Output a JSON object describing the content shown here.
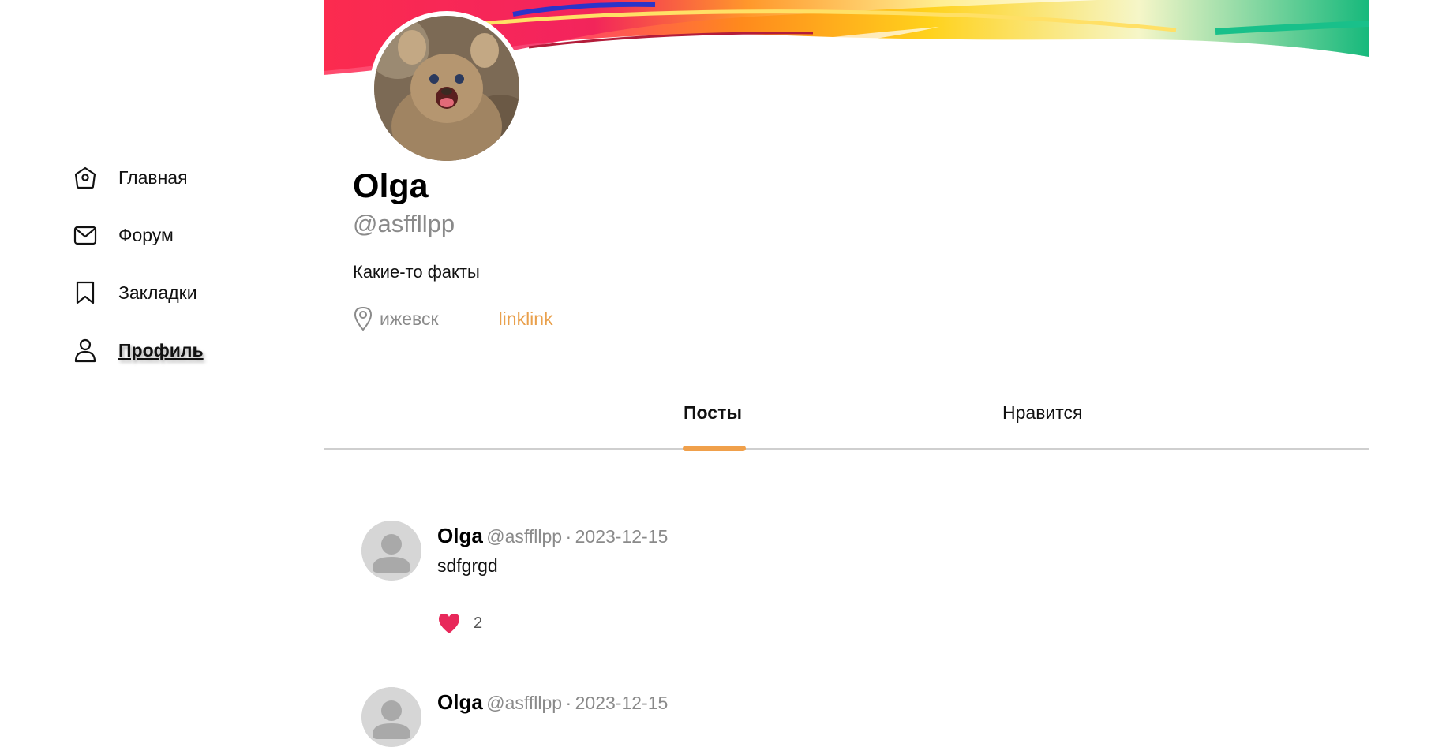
{
  "sidebar": {
    "items": [
      {
        "label": "Главная",
        "icon": "home-icon"
      },
      {
        "label": "Форум",
        "icon": "mail-icon"
      },
      {
        "label": "Закладки",
        "icon": "bookmark-icon"
      },
      {
        "label": "Профиль",
        "icon": "user-icon",
        "active": true
      }
    ]
  },
  "profile": {
    "name": "Olga",
    "handle": "@asffllpp",
    "bio": "Какие-то факты",
    "location": "ижевск",
    "link": "linklink"
  },
  "tabs": [
    {
      "label": "Посты",
      "active": true
    },
    {
      "label": "Нравится",
      "active": false
    }
  ],
  "posts": [
    {
      "author": "Olga",
      "handle": "@asffllpp",
      "separator": "·",
      "date": "2023-12-15",
      "text": "sdfgrgd",
      "likes": "2"
    },
    {
      "author": "Olga",
      "handle": "@asffllpp",
      "separator": "·",
      "date": "2023-12-15"
    }
  ],
  "colors": {
    "accent": "#f0a04b",
    "link": "#e9a04c",
    "heart": "#e8285a",
    "muted": "#8a8a8a",
    "divider": "#cfcfcf"
  }
}
